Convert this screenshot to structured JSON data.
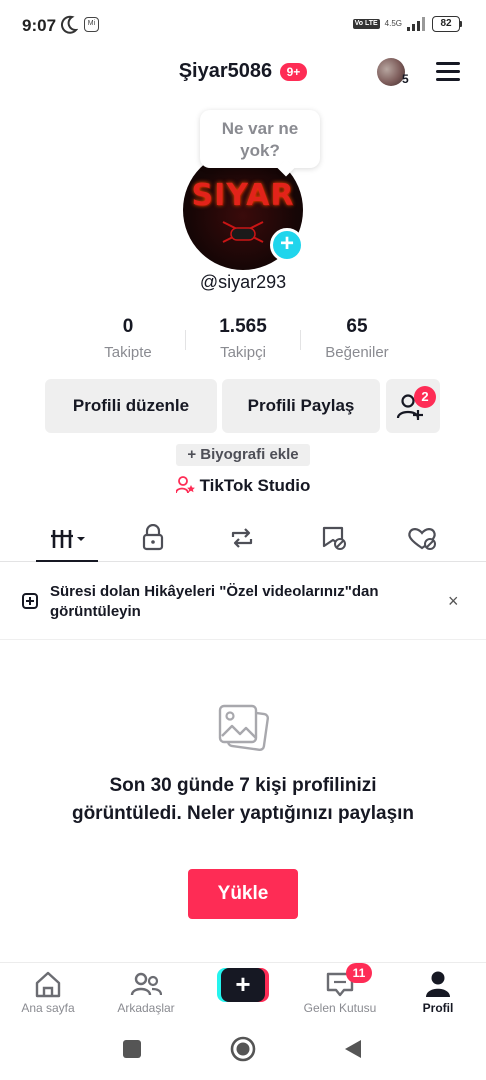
{
  "status_bar": {
    "time": "9:07",
    "volte": "Vo LTE",
    "network": "4.5G",
    "battery": "82"
  },
  "header": {
    "username": "Şiyar5086",
    "notification_badge": "9+",
    "account_count": "5"
  },
  "profile": {
    "note_bubble": "Ne var ne yok?",
    "avatar_text": "SIYAR",
    "handle": "@siyar293",
    "stats": [
      {
        "value": "0",
        "label": "Takipte"
      },
      {
        "value": "1.565",
        "label": "Takipçi"
      },
      {
        "value": "65",
        "label": "Beğeniler"
      }
    ],
    "edit_button": "Profili düzenle",
    "share_button": "Profili Paylaş",
    "add_friends_badge": "2",
    "bio_button": "+ Biyografi ekle",
    "studio_link": "TikTok Studio"
  },
  "tabs": [
    {
      "icon": "grid-icon",
      "active": true
    },
    {
      "icon": "lock-icon",
      "active": false
    },
    {
      "icon": "repost-icon",
      "active": false
    },
    {
      "icon": "bookmark-hidden-icon",
      "active": false
    },
    {
      "icon": "heart-hidden-icon",
      "active": false
    }
  ],
  "notice": {
    "text": "Süresi dolan Hikâyeleri \"Özel videolarınız\"dan görüntüleyin",
    "close": "×"
  },
  "empty_state": {
    "message": "Son 30 günde 7 kişi profilinizi görüntüledi. Neler yaptığınızı paylaşın",
    "upload_button": "Yükle"
  },
  "bottom_nav": {
    "home": "Ana sayfa",
    "friends": "Arkadaşlar",
    "create": "+",
    "inbox": "Gelen Kutusu",
    "inbox_badge": "11",
    "profile": "Profil"
  },
  "colors": {
    "accent": "#fe2c55",
    "cyan": "#25f4ee",
    "text": "#161823",
    "muted": "#8a8b91"
  }
}
